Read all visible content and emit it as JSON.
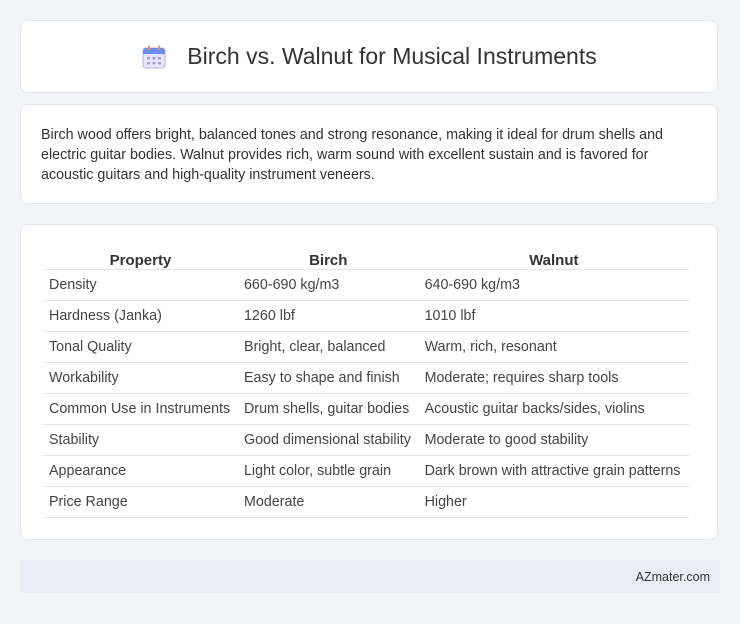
{
  "header": {
    "title": "Birch vs. Walnut for Musical Instruments",
    "icon": "calendar-icon"
  },
  "intro": {
    "text": "Birch wood offers bright, balanced tones and strong resonance, making it ideal for drum shells and electric guitar bodies. Walnut provides rich, warm sound with excellent sustain and is favored for acoustic guitars and high-quality instrument veneers."
  },
  "table": {
    "headers": [
      "Property",
      "Birch",
      "Walnut"
    ],
    "rows": [
      [
        "Density",
        "660-690 kg/m3",
        "640-690 kg/m3"
      ],
      [
        "Hardness (Janka)",
        "1260 lbf",
        "1010 lbf"
      ],
      [
        "Tonal Quality",
        "Bright, clear, balanced",
        "Warm, rich, resonant"
      ],
      [
        "Workability",
        "Easy to shape and finish",
        "Moderate; requires sharp tools"
      ],
      [
        "Common Use in Instruments",
        "Drum shells, guitar bodies",
        "Acoustic guitar backs/sides, violins"
      ],
      [
        "Stability",
        "Good dimensional stability",
        "Moderate to good stability"
      ],
      [
        "Appearance",
        "Light color, subtle grain",
        "Dark brown with attractive grain patterns"
      ],
      [
        "Price Range",
        "Moderate",
        "Higher"
      ]
    ]
  },
  "footer": {
    "text": "AZmater.com"
  },
  "colors": {
    "background": "#f2f4f8",
    "card": "#ffffff",
    "footer_bg": "#e8edf6",
    "icon_accent": "#5b8def"
  }
}
